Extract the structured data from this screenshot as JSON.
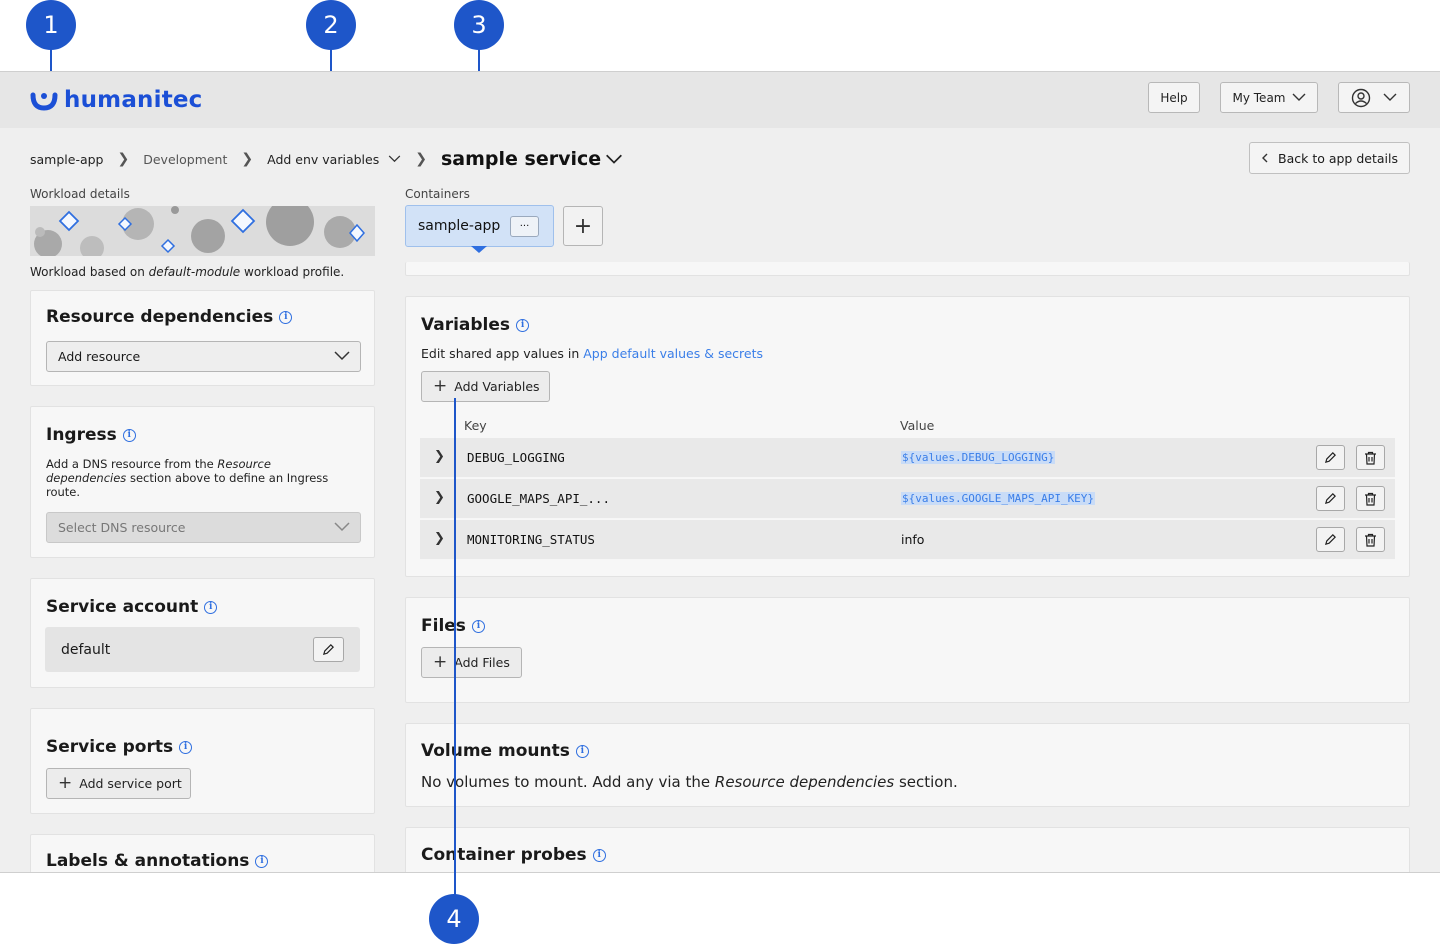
{
  "header": {
    "logo_text": "humanitec",
    "help_label": "Help",
    "team_label": "My Team"
  },
  "breadcrumb": {
    "app": "sample-app",
    "env": "Development",
    "deployment": "Add env variables",
    "workload": "sample service"
  },
  "back_label": "Back to app details",
  "left": {
    "workload_label": "Workload details",
    "workload_prefix": "Workload based on ",
    "workload_profile": "default-module",
    "workload_suffix": " workload profile.",
    "resource_deps": {
      "title": "Resource dependencies",
      "select_value": "Add resource"
    },
    "ingress": {
      "title": "Ingress",
      "desc_1": "Add a DNS resource from the ",
      "desc_em": "Resource dependencies",
      "desc_2": " section above to define an Ingress route.",
      "select_placeholder": "Select DNS resource"
    },
    "service_account": {
      "title": "Service account",
      "value": "default"
    },
    "service_ports": {
      "title": "Service ports",
      "add_label": "Add service port"
    },
    "labels": {
      "title": "Labels & annotations"
    }
  },
  "containers": {
    "label": "Containers",
    "tab_name": "sample-app",
    "more_label": "···"
  },
  "variables": {
    "title": "Variables",
    "edit_text": "Edit shared app values in ",
    "edit_link": "App default values & secrets",
    "add_label": "Add Variables",
    "col_key": "Key",
    "col_value": "Value",
    "rows": [
      {
        "key": "DEBUG_LOGGING",
        "value": "${values.DEBUG_LOGGING}"
      },
      {
        "key": "GOOGLE_MAPS_API_...",
        "value": "${values.GOOGLE_MAPS_API_KEY}"
      },
      {
        "key": "MONITORING_STATUS",
        "value": "info"
      }
    ]
  },
  "files": {
    "title": "Files",
    "add_label": "Add Files"
  },
  "volumes": {
    "title": "Volume mounts",
    "text_1": "No volumes to mount. Add any via the ",
    "text_em": "Resource dependencies",
    "text_2": " section."
  },
  "probes": {
    "title": "Container probes"
  },
  "markers": [
    "1",
    "2",
    "3",
    "4"
  ],
  "colors": {
    "brand": "#1b4fd6",
    "marker": "#1e56c9",
    "link": "#3a7ee8"
  }
}
